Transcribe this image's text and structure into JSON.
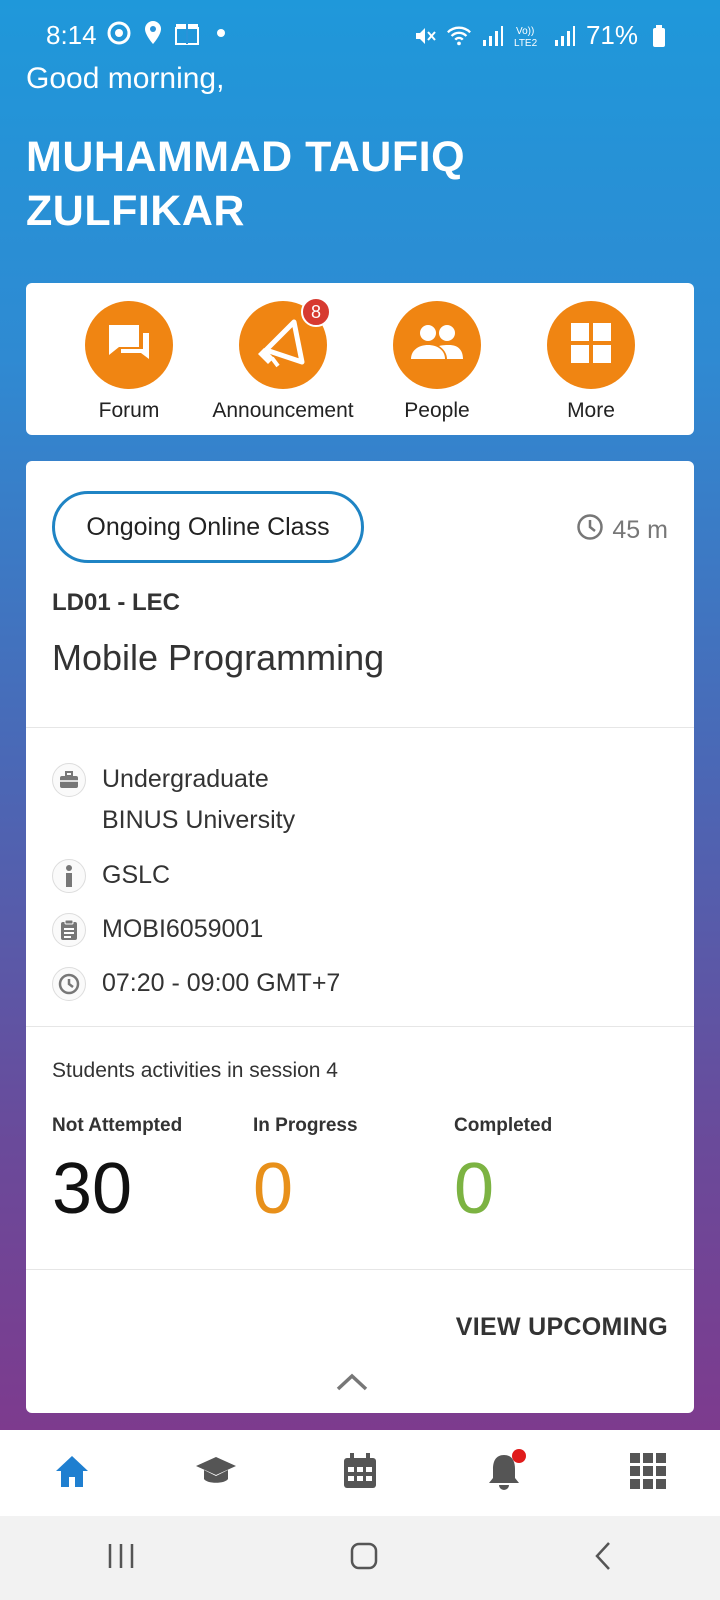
{
  "status_bar": {
    "time": "8:14",
    "battery": "71%",
    "left_icons": [
      "target-icon",
      "location-icon",
      "gift-icon",
      "dot-icon"
    ],
    "right_icons": [
      "mute-icon",
      "wifi-icon",
      "signal-icon",
      "volte-icon",
      "signal-icon",
      "battery-icon"
    ]
  },
  "header": {
    "greeting": "Good morning,",
    "user_name": "MUHAMMAD TAUFIQ ZULFIKAR"
  },
  "quick_menu": [
    {
      "label": "Forum",
      "icon": "forum-icon"
    },
    {
      "label": "Announcement",
      "icon": "megaphone-icon",
      "badge": "8"
    },
    {
      "label": "People",
      "icon": "people-icon"
    },
    {
      "label": "More",
      "icon": "grid-icon"
    }
  ],
  "class_card": {
    "status": "Ongoing Online Class",
    "duration": "45 m",
    "code": "LD01 - LEC",
    "name": "Mobile Programming",
    "program_line1": "Undergraduate",
    "program_line2": "BINUS University",
    "type": "GSLC",
    "course_code": "MOBI6059001",
    "time": "07:20 - 09:00 GMT+7",
    "activities_title": "Students activities in session 4",
    "stats": [
      {
        "label": "Not Attempted",
        "value": "30",
        "color": "#111111"
      },
      {
        "label": "In Progress",
        "value": "0",
        "color": "#e8901a"
      },
      {
        "label": "Completed",
        "value": "0",
        "color": "#7cb342"
      }
    ],
    "view_upcoming": "VIEW UPCOMING"
  },
  "bottom_nav": [
    {
      "icon": "home-icon",
      "active": true
    },
    {
      "icon": "graduation-cap-icon"
    },
    {
      "icon": "calendar-icon"
    },
    {
      "icon": "bell-icon",
      "notification_dot": true
    },
    {
      "icon": "apps-grid-icon"
    }
  ],
  "colors": {
    "accent_orange": "#f08512",
    "active_blue": "#1f7fd0",
    "badge_red": "#d73a30"
  }
}
